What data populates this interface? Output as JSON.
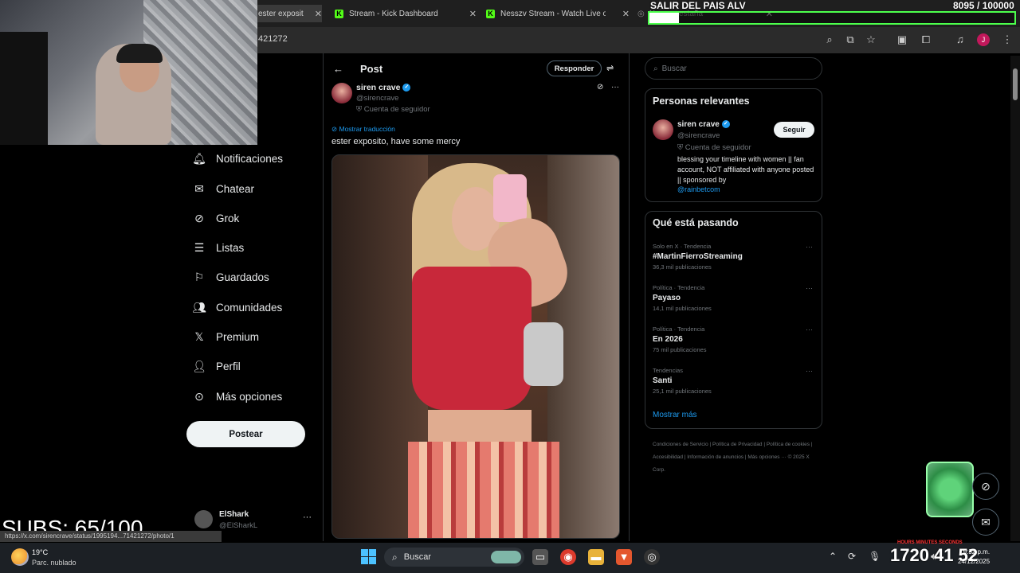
{
  "browser": {
    "tabs": [
      {
        "title": "ester exposit",
        "icon": "x-logo-icon"
      },
      {
        "title": "Stream - Kick Dashboard",
        "icon": "kick-icon"
      },
      {
        "title": "Nesszv Stream - Watch Live on",
        "icon": "kick-icon"
      },
      {
        "title": "Nueva pestaña",
        "icon": "chrome-icon"
      }
    ],
    "url": "421272"
  },
  "overlay": {
    "goal_title": "SALIR DEL PAIS ALV",
    "goal_count": "8095 / 100000",
    "goal_progress": 0.081,
    "subs": "SUBS: 65/100",
    "timer_labels": "HOURS    MINUTES    SECONDS",
    "timer_values": "1720   41   52",
    "status_url": "https://x.com/sirencrave/status/1995194...71421272/photo/1"
  },
  "nav": {
    "items": [
      {
        "label": "Notificaciones",
        "icon": "bell-icon"
      },
      {
        "label": "Chatear",
        "icon": "mail-icon"
      },
      {
        "label": "Grok",
        "icon": "grok-icon"
      },
      {
        "label": "Listas",
        "icon": "list-icon"
      },
      {
        "label": "Guardados",
        "icon": "bookmark-icon"
      },
      {
        "label": "Comunidades",
        "icon": "people-icon"
      },
      {
        "label": "Premium",
        "icon": "x-logo-icon"
      },
      {
        "label": "Perfil",
        "icon": "person-icon"
      },
      {
        "label": "Más opciones",
        "icon": "more-circle-icon"
      }
    ],
    "post_button": "Postear",
    "account": {
      "name": "ElShark",
      "handle": "@ElSharkL"
    }
  },
  "post": {
    "header": "Post",
    "reply_button": "Responder",
    "author_name": "siren crave",
    "author_handle": "@sirencrave",
    "author_sub": "Cuenta de seguidor",
    "translate": "Mostrar traducción",
    "text": "ester exposito, have some mercy"
  },
  "sidebar": {
    "search_placeholder": "Buscar",
    "relevant": {
      "title": "Personas relevantes",
      "name": "siren crave",
      "handle": "@sirencrave",
      "sub": "Cuenta de seguidor",
      "follow": "Seguir",
      "bio": "blessing your timeline with women || fan account, NOT affiliated with anyone posted || sponsored by",
      "link": "@rainbetcom"
    },
    "trending": {
      "title": "Qué está pasando",
      "items": [
        {
          "context": "Solo en X · Tendencia",
          "name": "#MartinFierroStreaming",
          "count": "36,3 mil publicaciones"
        },
        {
          "context": "Política · Tendencia",
          "name": "Payaso",
          "count": "14,1 mil publicaciones"
        },
        {
          "context": "Política · Tendencia",
          "name": "En 2026",
          "count": "75 mil publicaciones"
        },
        {
          "context": "Tendencias",
          "name": "Santi",
          "count": "25,1 mil publicaciones"
        }
      ],
      "show_more": "Mostrar más"
    },
    "footer": "Condiciones de Servicio  |  Política de Privacidad  |  Política de cookies  |  Accesibilidad  |  Información de anuncios  |  Más opciones ···  © 2025 X Corp."
  },
  "taskbar": {
    "weather_temp": "19°C",
    "weather_desc": "Parc. nublado",
    "search": "Buscar",
    "time": "9:32 p.m.",
    "date": "24/12/2025"
  },
  "colors": {
    "accent": "#1d9bf0",
    "goal_border": "#4cff4c",
    "kick": "#53fc18"
  }
}
